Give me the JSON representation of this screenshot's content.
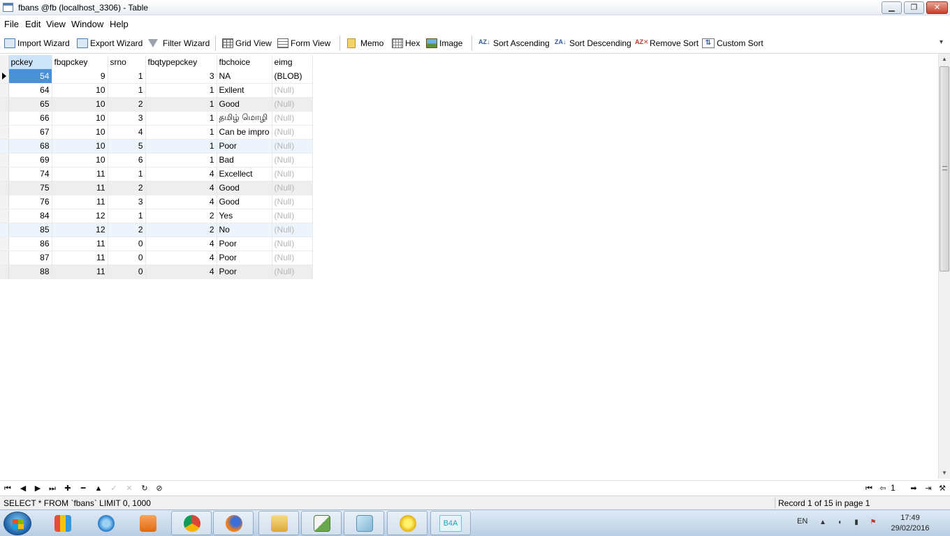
{
  "window": {
    "title": "fbans @fb (localhost_3306) - Table",
    "controls": {
      "minimize": "▁",
      "maximize": "❐",
      "close": "✕"
    }
  },
  "menu": [
    "File",
    "Edit",
    "View",
    "Window",
    "Help"
  ],
  "toolbar": {
    "import_wizard": "Import Wizard",
    "export_wizard": "Export Wizard",
    "filter_wizard": "Filter Wizard",
    "grid_view": "Grid View",
    "form_view": "Form View",
    "memo": "Memo",
    "hex": "Hex",
    "image": "Image",
    "sort_ascending": "Sort Ascending",
    "sort_descending": "Sort Descending",
    "remove_sort": "Remove Sort",
    "custom_sort": "Custom Sort",
    "sort_asc_glyph": "AZ↓",
    "sort_desc_glyph": "ZA↓",
    "remove_sort_glyph": "AZ✕",
    "custom_sort_glyph": "⇅",
    "more_glyph": "▾"
  },
  "grid": {
    "columns": [
      "pckey",
      "fbqpckey",
      "srno",
      "fbqtypepckey",
      "fbchoice",
      "eimg"
    ],
    "rows": [
      [
        "54",
        "9",
        "1",
        "3",
        "NA",
        "(BLOB)"
      ],
      [
        "64",
        "10",
        "1",
        "1",
        "Exllent",
        "(Null)"
      ],
      [
        "65",
        "10",
        "2",
        "1",
        "Good",
        "(Null)"
      ],
      [
        "66",
        "10",
        "3",
        "1",
        "தமிழ் மொழி",
        "(Null)"
      ],
      [
        "67",
        "10",
        "4",
        "1",
        "Can be impro",
        "(Null)"
      ],
      [
        "68",
        "10",
        "5",
        "1",
        "Poor",
        "(Null)"
      ],
      [
        "69",
        "10",
        "6",
        "1",
        "Bad",
        "(Null)"
      ],
      [
        "74",
        "11",
        "1",
        "4",
        "Excellect",
        "(Null)"
      ],
      [
        "75",
        "11",
        "2",
        "4",
        "Good",
        "(Null)"
      ],
      [
        "76",
        "11",
        "3",
        "4",
        "Good",
        "(Null)"
      ],
      [
        "84",
        "12",
        "1",
        "2",
        "Yes",
        "(Null)"
      ],
      [
        "85",
        "12",
        "2",
        "2",
        "No",
        "(Null)"
      ],
      [
        "86",
        "11",
        "0",
        "4",
        "Poor",
        "(Null)"
      ],
      [
        "87",
        "11",
        "0",
        "4",
        "Poor",
        "(Null)"
      ],
      [
        "88",
        "11",
        "0",
        "4",
        "Poor",
        "(Null)"
      ]
    ]
  },
  "navigation": {
    "first": "⏮",
    "prev": "◀",
    "next": "▶",
    "last": "⏭",
    "add": "✚",
    "delete": "━",
    "up": "▲",
    "apply": "✓",
    "cancel": "✕",
    "refresh": "↻",
    "stop": "⊘",
    "page_first": "⏮",
    "page_prev": "⇦",
    "page_number": "1",
    "page_next": "➡",
    "page_last": "⇥",
    "page_settings": "⚒"
  },
  "status": {
    "sql": "SELECT * FROM `fbans` LIMIT 0, 1000",
    "record": "Record 1 of 15 in page 1"
  },
  "taskbar": {
    "language": "EN",
    "time": "17:49",
    "date": "29/02/2016",
    "b4a_label": "B4A",
    "tray_up": "▲",
    "tray_speaker": "◖",
    "tray_signal": "▮",
    "tray_flag": "⚑"
  },
  "colors": {
    "selected_cell": "#4a90d9",
    "null_text": "#b5b5b5",
    "alt_row": "#eeeeee",
    "blue_row": "#eef4fb"
  }
}
